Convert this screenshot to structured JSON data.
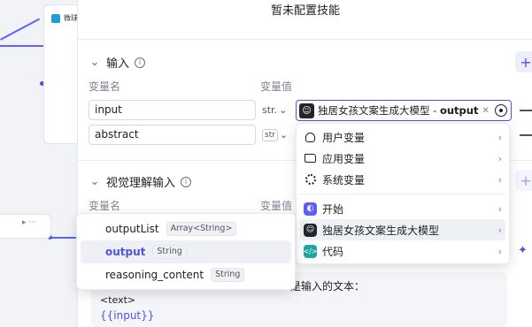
{
  "colors": {
    "accent": "#4d53e8",
    "edge": "#5c62ff"
  },
  "canvas": {
    "node_label": "微球"
  },
  "panel": {
    "title": "暂未配置技能",
    "input_section": {
      "title": "输入",
      "col_name": "变量名",
      "col_value": "变量值",
      "rows": [
        {
          "name": "input",
          "type": "str.",
          "ref_source": "独居女孩文案生成大模型",
          "ref_sep": " - ",
          "ref_field": "output"
        },
        {
          "name": "abstract",
          "type": "str"
        }
      ]
    },
    "visual_section": {
      "title": "视觉理解输入",
      "col_name": "变量名",
      "col_value": "变量值"
    },
    "prompt": {
      "line1": "是输入的文本：",
      "line2": "<text>",
      "line3": "{{input}}"
    }
  },
  "var_menu": {
    "items": [
      {
        "name": "outputList",
        "type": "Array<String>"
      },
      {
        "name": "output",
        "type": "String",
        "active": true
      },
      {
        "name": "reasoning_content",
        "type": "String"
      }
    ]
  },
  "src_menu": {
    "groups_top": [
      {
        "label": "用户变量",
        "icon": "user-icon"
      },
      {
        "label": "应用变量",
        "icon": "folder-icon"
      },
      {
        "label": "系统变量",
        "icon": "gear-icon"
      }
    ],
    "groups_bottom": [
      {
        "label": "开始",
        "icon": "start-icon"
      },
      {
        "label": "独居女孩文案生成大模型",
        "icon": "model-icon",
        "active": true
      },
      {
        "label": "代码",
        "icon": "code-icon"
      }
    ]
  }
}
